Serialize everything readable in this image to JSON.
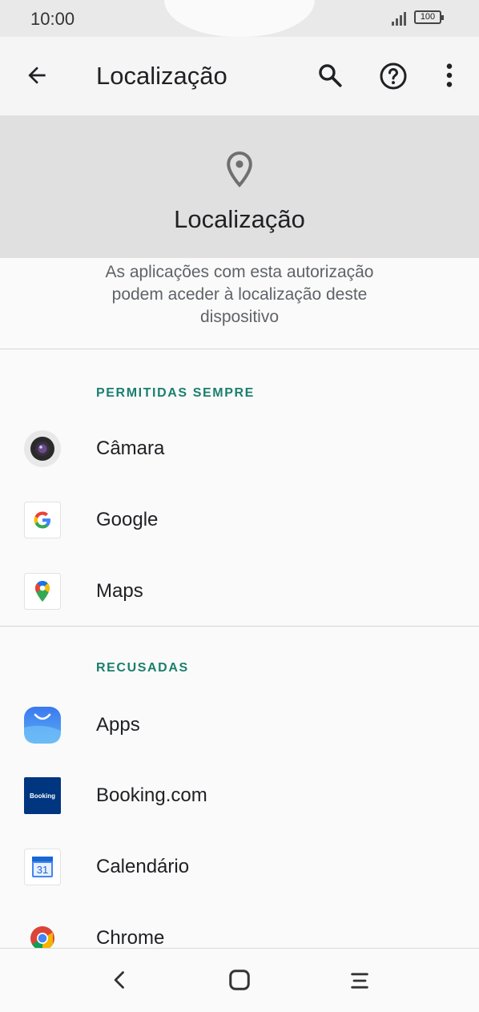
{
  "status_bar": {
    "time": "10:00",
    "battery": "100"
  },
  "app_bar": {
    "title": "Localização"
  },
  "header": {
    "title": "Localização"
  },
  "description": "As aplicações com esta autorização podem aceder à localização deste dispositivo",
  "sections": [
    {
      "title": "PERMITIDAS SEMPRE",
      "apps": [
        {
          "name": "Câmara",
          "icon": "camera-app-icon"
        },
        {
          "name": "Google",
          "icon": "google-app-icon"
        },
        {
          "name": "Maps",
          "icon": "maps-app-icon"
        }
      ]
    },
    {
      "title": "RECUSADAS",
      "apps": [
        {
          "name": "Apps",
          "icon": "galaxy-store-icon"
        },
        {
          "name": "Booking.com",
          "icon": "booking-app-icon",
          "icon_text": "Booking"
        },
        {
          "name": "Calendário",
          "icon": "calendar-app-icon",
          "icon_text": "31"
        },
        {
          "name": "Chrome",
          "icon": "chrome-app-icon"
        }
      ]
    }
  ],
  "colors": {
    "accent": "#1a7f6e",
    "header_bg": "#e0e0e0",
    "background": "#fafafa"
  }
}
